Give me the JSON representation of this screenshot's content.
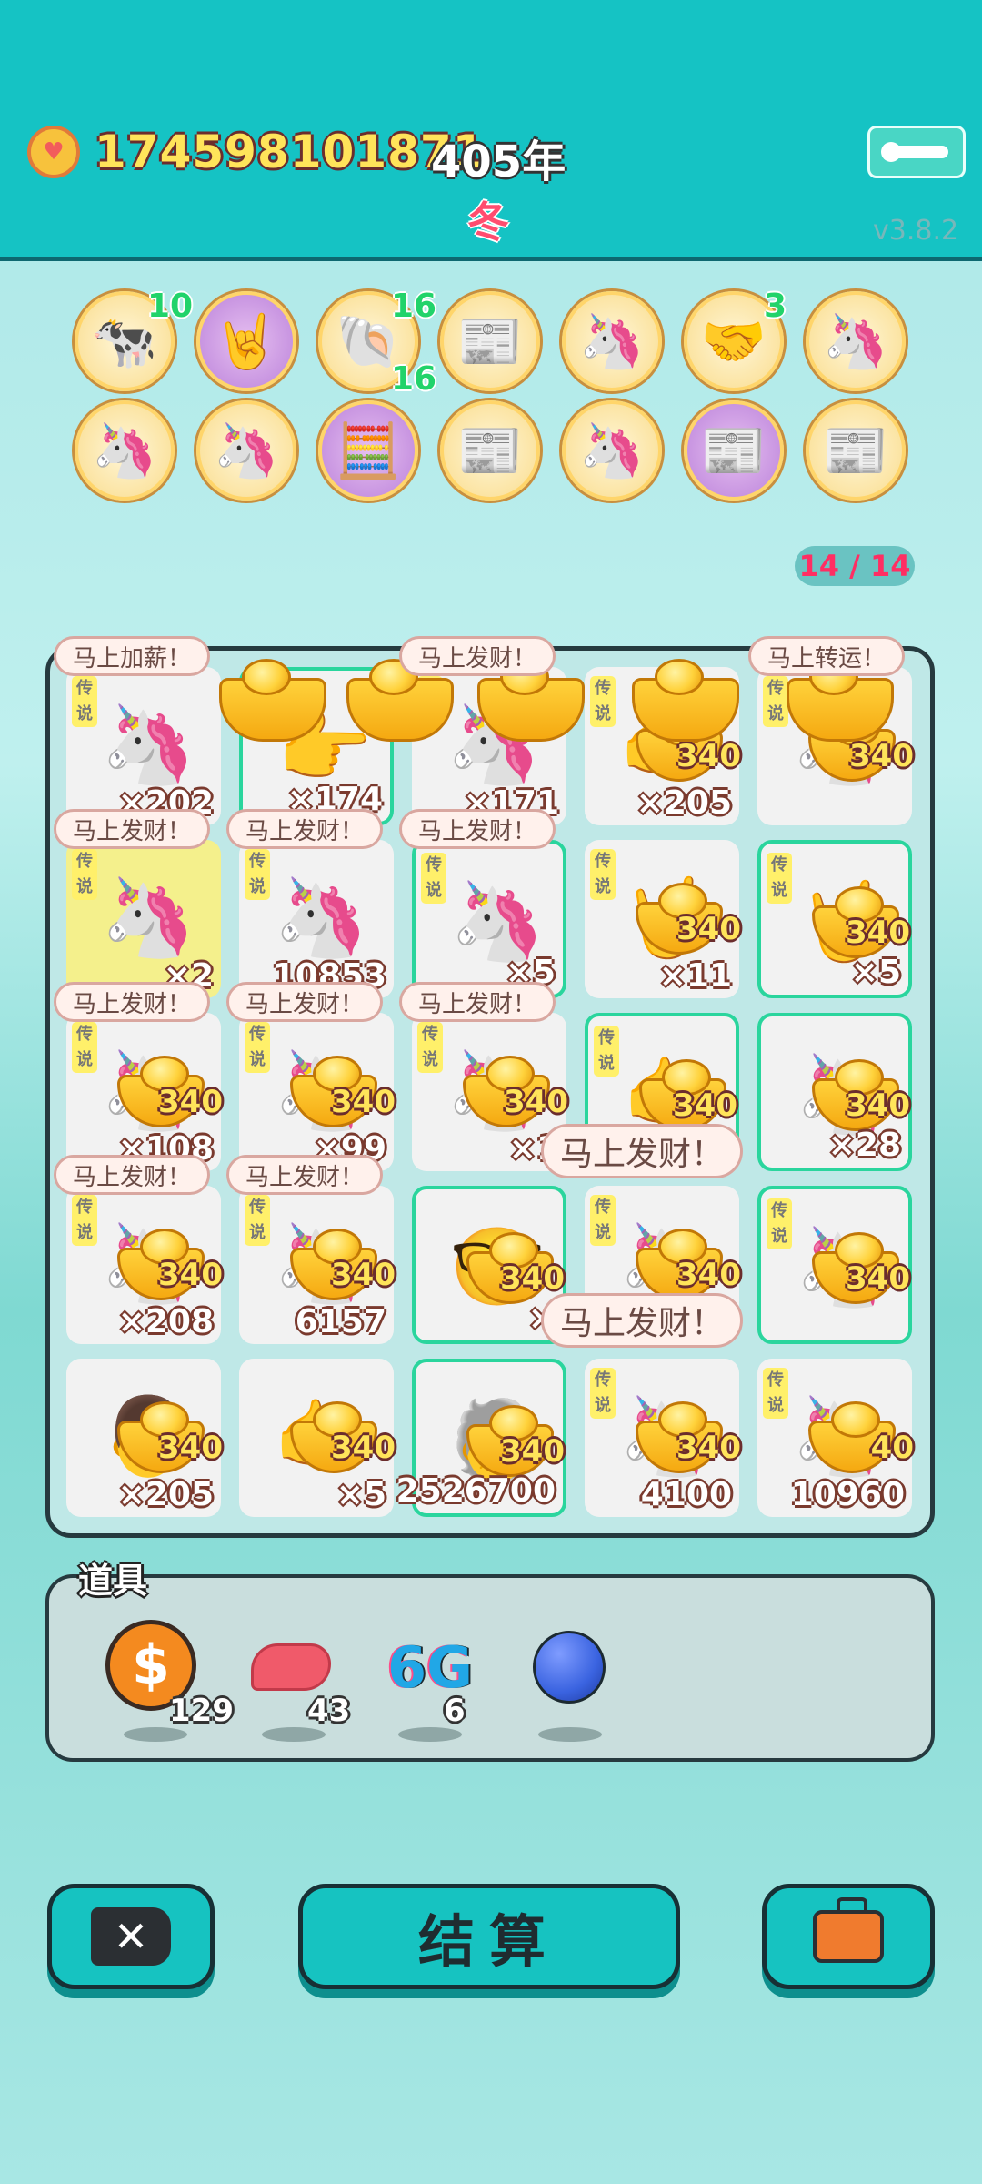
{
  "header": {
    "money": "174598101871",
    "year": "405年",
    "season": "冬",
    "version": "v3.8.2",
    "menu_icon": "menu-icon",
    "coin_icon": "heart-coin-icon"
  },
  "collection": {
    "row1": [
      {
        "icon": "cow-pair",
        "glyph": "🐄",
        "badge": "10"
      },
      {
        "icon": "rock-hand",
        "glyph": "🤘",
        "badge": ""
      },
      {
        "icon": "shell",
        "glyph": "🐚",
        "badge": "16",
        "badge2": "16"
      },
      {
        "icon": "time-magazine",
        "glyph": "📰",
        "badge": ""
      },
      {
        "icon": "unicorn",
        "glyph": "🦄",
        "badge": ""
      },
      {
        "icon": "handshake",
        "glyph": "🤝",
        "badge": "3"
      },
      {
        "icon": "unicorn",
        "glyph": "🦄",
        "badge": ""
      }
    ],
    "row2": [
      {
        "icon": "unicorn",
        "glyph": "🦄"
      },
      {
        "icon": "unicorn",
        "glyph": "🦄"
      },
      {
        "icon": "math-genius",
        "glyph": "🧮"
      },
      {
        "icon": "time-magazine",
        "glyph": "📰"
      },
      {
        "icon": "unicorn",
        "glyph": "🦄"
      },
      {
        "icon": "time-magazine",
        "glyph": "📰"
      },
      {
        "icon": "time-magazine",
        "glyph": "📰"
      }
    ],
    "counter": "14 / 14"
  },
  "board": {
    "legend_tag": "传说",
    "cells": [
      {
        "glyph": "🦄",
        "count": "×202",
        "gain": "",
        "tag": true
      },
      {
        "glyph": "👉",
        "count": "×174",
        "gain": "",
        "tag": false
      },
      {
        "glyph": "🦄",
        "count": "×171",
        "gain": "",
        "tag": true
      },
      {
        "glyph": "👉",
        "count": "×205",
        "gain": "340",
        "tag": true
      },
      {
        "glyph": "🦄",
        "count": "",
        "gain": "340",
        "tag": true
      },
      {
        "glyph": "🦄",
        "count": "×2",
        "gain": "",
        "tag": true
      },
      {
        "glyph": "🦄",
        "count": "10853",
        "gain": "",
        "tag": true
      },
      {
        "glyph": "🦄",
        "count": "×5",
        "gain": "",
        "tag": true
      },
      {
        "glyph": "🤘",
        "count": "×11",
        "gain": "340",
        "tag": true
      },
      {
        "glyph": "🤘",
        "count": "×5",
        "gain": "340",
        "tag": true
      },
      {
        "glyph": "🦄",
        "count": "×108",
        "gain": "340",
        "tag": true
      },
      {
        "glyph": "🦄",
        "count": "×99",
        "gain": "340",
        "tag": true
      },
      {
        "glyph": "🦄",
        "count": "×1",
        "gain": "340",
        "tag": true
      },
      {
        "glyph": "👉",
        "count": "",
        "gain": "340",
        "tag": true
      },
      {
        "glyph": "🦄",
        "count": "×28",
        "gain": "340",
        "tag": false
      },
      {
        "glyph": "🦄",
        "count": "×208",
        "gain": "340",
        "tag": true
      },
      {
        "glyph": "🦄",
        "count": "6157",
        "gain": "340",
        "tag": true
      },
      {
        "glyph": "🤓",
        "count": "×",
        "gain": "340",
        "tag": false
      },
      {
        "glyph": "🦄",
        "count": "",
        "gain": "340",
        "tag": true
      },
      {
        "glyph": "🦄",
        "count": "",
        "gain": "340",
        "tag": true
      },
      {
        "glyph": "👨",
        "count": "×205",
        "gain": "340",
        "tag": false
      },
      {
        "glyph": "👉",
        "count": "×5",
        "gain": "340",
        "tag": false
      },
      {
        "glyph": "🧓",
        "count": "2526700",
        "gain": "340",
        "tag": false
      },
      {
        "glyph": "🦄",
        "count": "4100",
        "gain": "340",
        "tag": true
      },
      {
        "glyph": "🦄",
        "count": "10960",
        "gain": "40",
        "tag": true
      }
    ],
    "bubbles": [
      "马上加薪！",
      "马上发财！",
      "马上转运！",
      "马上发财！",
      "马上发财！",
      "马上发财！",
      "马上发财！",
      "马上发财！",
      "马上发财！",
      "马上发财！",
      "马上发财！",
      "马上发财！",
      "马上发财！"
    ]
  },
  "items": {
    "title": "道具",
    "list": [
      {
        "icon": "dollar-coin-icon",
        "count": "129",
        "color": "#f48a1f"
      },
      {
        "icon": "liver-icon",
        "count": "43",
        "color": "#f05a6a"
      },
      {
        "icon": "6g-icon",
        "count": "6",
        "text": "6G"
      },
      {
        "icon": "blueberry-icon",
        "count": "",
        "color": "#3a63e0"
      }
    ]
  },
  "buttons": {
    "close_label": "✕",
    "settle_label": "结算",
    "bag_icon": "briefcase-icon"
  }
}
